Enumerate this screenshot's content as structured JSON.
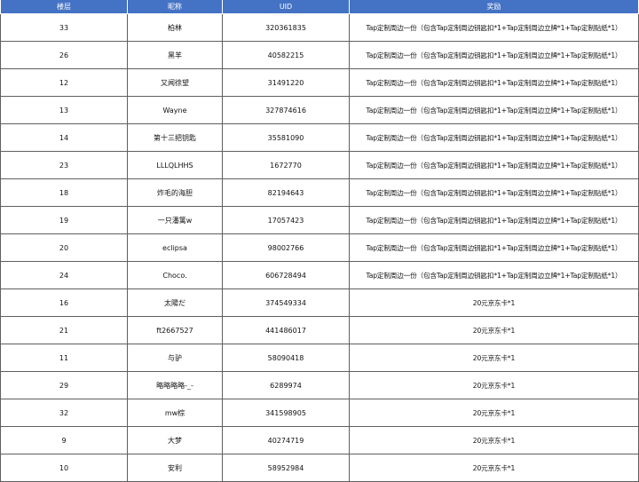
{
  "table": {
    "headers": [
      "楼层",
      "昵称",
      "UID",
      "奖励"
    ],
    "rows": [
      [
        "33",
        "柏林",
        "320361835",
        "Tap定制周边一份（包含Tap定制周边钥匙扣*1+Tap定制周边立牌*1+Tap定制贴纸*1）"
      ],
      [
        "26",
        "黑羊",
        "40582215",
        "Tap定制周边一份（包含Tap定制周边钥匙扣*1+Tap定制周边立牌*1+Tap定制贴纸*1）"
      ],
      [
        "12",
        "又闻徐望",
        "31491220",
        "Tap定制周边一份（包含Tap定制周边钥匙扣*1+Tap定制周边立牌*1+Tap定制贴纸*1）"
      ],
      [
        "13",
        "Wayne",
        "327874616",
        "Tap定制周边一份（包含Tap定制周边钥匙扣*1+Tap定制周边立牌*1+Tap定制贴纸*1）"
      ],
      [
        "14",
        "第十三把钥匙",
        "35581090",
        "Tap定制周边一份（包含Tap定制周边钥匙扣*1+Tap定制周边立牌*1+Tap定制贴纸*1）"
      ],
      [
        "23",
        "LLLQLHHS",
        "1672770",
        "Tap定制周边一份（包含Tap定制周边钥匙扣*1+Tap定制周边立牌*1+Tap定制贴纸*1）"
      ],
      [
        "18",
        "炸毛的海胆",
        "82194643",
        "Tap定制周边一份（包含Tap定制周边钥匙扣*1+Tap定制周边立牌*1+Tap定制贴纸*1）"
      ],
      [
        "19",
        "一只潘篱w",
        "17057423",
        "Tap定制周边一份（包含Tap定制周边钥匙扣*1+Tap定制周边立牌*1+Tap定制贴纸*1）"
      ],
      [
        "20",
        "eclipsa",
        "98002766",
        "Tap定制周边一份（包含Tap定制周边钥匙扣*1+Tap定制周边立牌*1+Tap定制贴纸*1）"
      ],
      [
        "24",
        "Choco.",
        "606728494",
        "Tap定制周边一份（包含Tap定制周边钥匙扣*1+Tap定制周边立牌*1+Tap定制贴纸*1）"
      ],
      [
        "16",
        "太陽だ",
        "374549334",
        "20元京东卡*1"
      ],
      [
        "21",
        "ft2667527",
        "441486017",
        "20元京东卡*1"
      ],
      [
        "11",
        "与驴",
        "58090418",
        "20元京东卡*1"
      ],
      [
        "29",
        "略略略略-_-",
        "6289974",
        "20元京东卡*1"
      ],
      [
        "32",
        "mw棕",
        "341598905",
        "20元京东卡*1"
      ],
      [
        "9",
        "大梦",
        "40274719",
        "20元京东卡*1"
      ],
      [
        "10",
        "安利",
        "58952984",
        "20元京东卡*1"
      ]
    ]
  },
  "colors": {
    "header_background": "#4472c4",
    "header_text": "#ffffff",
    "border": "#5f5f5f"
  }
}
